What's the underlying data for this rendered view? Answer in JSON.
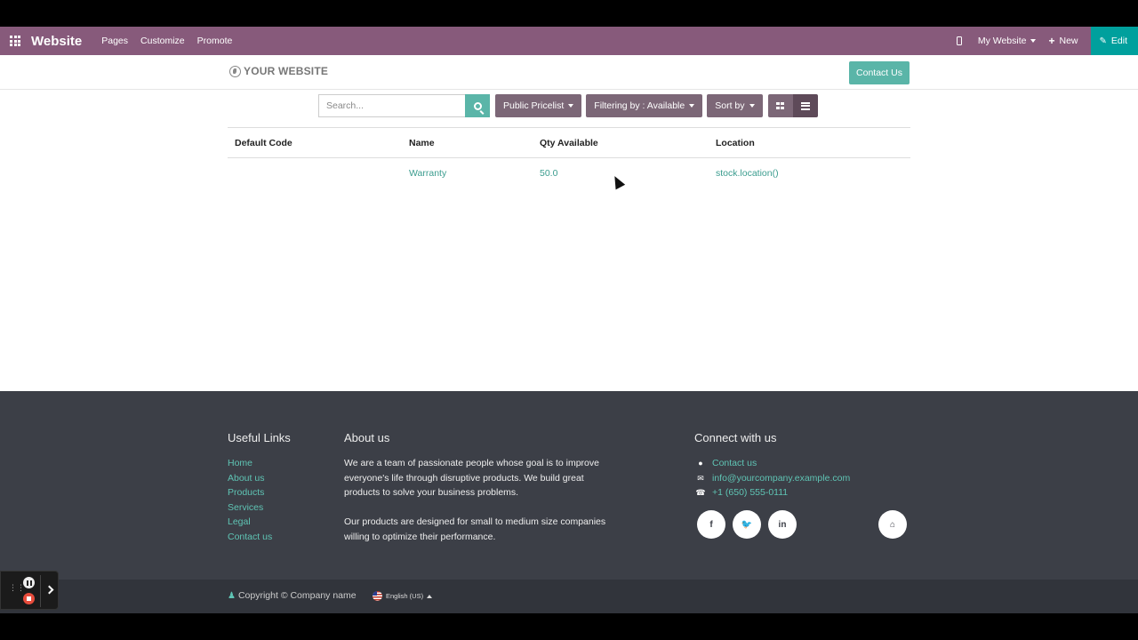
{
  "topbar": {
    "brand": "Website",
    "menu": [
      "Pages",
      "Customize",
      "Promote"
    ],
    "website_selector": "My Website",
    "new_label": "New",
    "edit_label": "Edit",
    "color": "#875a7b",
    "edit_color": "#00a09d"
  },
  "header": {
    "logo_text": "YOUR WEBSITE",
    "contact_button": "Contact Us"
  },
  "toolbar": {
    "search_placeholder": "Search...",
    "pricelist": "Public Pricelist",
    "filter": "Filtering by : Available",
    "sort": "Sort by"
  },
  "table": {
    "columns": [
      "Default Code",
      "Name",
      "Qty Available",
      "Location"
    ],
    "rows": [
      {
        "code": "",
        "name": "Warranty",
        "qty": "50.0",
        "location": "stock.location()"
      }
    ]
  },
  "footer": {
    "useful_links_title": "Useful Links",
    "useful_links": [
      "Home",
      "About us",
      "Products",
      "Services",
      "Legal",
      "Contact us"
    ],
    "about_title": "About us",
    "about_p1": "We are a team of passionate people whose goal is to improve everyone's life through disruptive products. We build great products to solve your business problems.",
    "about_p2": "Our products are designed for small to medium size companies willing to optimize their performance.",
    "connect_title": "Connect with us",
    "connect_contact": "Contact us",
    "connect_email": "info@yourcompany.example.com",
    "connect_phone": "+1 (650) 555-0111",
    "social_icons": [
      "facebook-icon",
      "twitter-icon",
      "linkedin-icon",
      "home-icon"
    ]
  },
  "copyright": {
    "text": "Copyright © Company name",
    "language": "English (US)"
  }
}
